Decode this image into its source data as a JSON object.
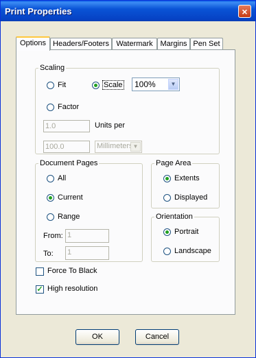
{
  "window": {
    "title": "Print Properties",
    "close_icon": "×"
  },
  "tabs": [
    {
      "label": "Options",
      "active": true
    },
    {
      "label": "Headers/Footers"
    },
    {
      "label": "Watermark"
    },
    {
      "label": "Margins"
    },
    {
      "label": "Pen Set"
    }
  ],
  "scaling": {
    "legend": "Scaling",
    "fit_label": "Fit",
    "scale_label": "Scale",
    "scale_value": "100%",
    "factor_label": "Factor",
    "factor_value": "1.0",
    "units_per_label": "Units per",
    "units_value": "100.0",
    "units_select": "Millimeters",
    "selected": "scale"
  },
  "document_pages": {
    "legend": "Document Pages",
    "all_label": "All",
    "current_label": "Current",
    "range_label": "Range",
    "from_label": "From:",
    "from_value": "1",
    "to_label": "To:",
    "to_value": "1",
    "selected": "current"
  },
  "page_area": {
    "legend": "Page Area",
    "extents_label": "Extents",
    "displayed_label": "Displayed",
    "selected": "extents"
  },
  "orientation": {
    "legend": "Orientation",
    "portrait_label": "Portrait",
    "landscape_label": "Landscape",
    "selected": "portrait"
  },
  "options": {
    "force_black_label": "Force To Black",
    "force_black_checked": false,
    "high_res_label": "High resolution",
    "high_res_checked": true
  },
  "buttons": {
    "ok": "OK",
    "cancel": "Cancel"
  },
  "colors": {
    "title_bar": "#0a54d6",
    "dialog_bg": "#ece9d8",
    "tab_highlight": "#ffc83c",
    "radio_dot": "#21a121"
  }
}
